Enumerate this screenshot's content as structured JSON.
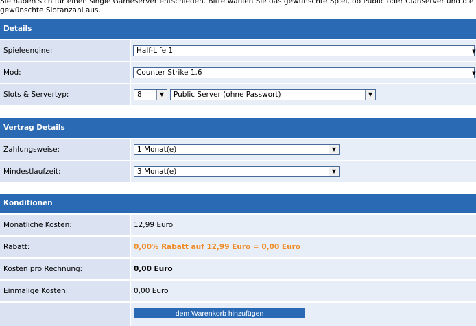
{
  "intro": "Sie haben sich für einen single Gameserver entschieden. Bitte wählen Sie das gewünschte Spiel, ob Public oder Clanserver und die gewünschte Slotanzahl aus.",
  "details": {
    "title": "Details",
    "spieleengine_label": "Spieleengine:",
    "spieleengine_value": "Half-Life 1",
    "mod_label": "Mod:",
    "mod_value": "Counter Strike 1.6",
    "slots_label": "Slots & Servertyp:",
    "slots_value": "8",
    "servertyp_value": "Public Server (ohne Passwort)"
  },
  "vertrag": {
    "title": "Vertrag Details",
    "zahlungsweise_label": "Zahlungsweise:",
    "zahlungsweise_value": "1 Monat(e)",
    "mindestlaufzeit_label": "Mindestlaufzeit:",
    "mindestlaufzeit_value": "3 Monat(e)"
  },
  "konditionen": {
    "title": "Konditionen",
    "monatlich_label": "Monatliche Kosten:",
    "monatlich_value": "12,99 Euro",
    "rabatt_label": "Rabatt:",
    "rabatt_value": "0,00% Rabatt auf 12,99 Euro = 0,00 Euro",
    "kosten_rechnung_label": "Kosten pro Rechnung:",
    "kosten_rechnung_value": "0,00 Euro",
    "einmalig_label": "Einmalige Kosten:",
    "einmalig_value": "0,00 Euro"
  },
  "button_label": "dem Warenkorb hinzufügen",
  "colors": {
    "header_bg": "#2a6ab4",
    "label_bg": "#dbe3f3",
    "value_bg": "#e8eef7",
    "accent_orange": "#f08a24"
  }
}
